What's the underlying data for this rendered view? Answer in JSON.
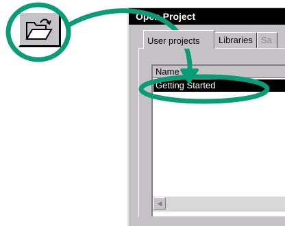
{
  "toolbar": {
    "open_button_icon": "open-folder-icon"
  },
  "dialog": {
    "title": "Open Project",
    "tabs": [
      {
        "label": "User projects",
        "active": true
      },
      {
        "label": "Libraries",
        "active": false
      },
      {
        "label": "Sa",
        "active": false,
        "disabled": true
      }
    ],
    "list": {
      "column_header": "Name",
      "selected_item": "Getting Started"
    }
  },
  "annotation": {
    "color": "#0a9c77",
    "icon": "curved-arrow"
  },
  "colors": {
    "dialog_bg": "#c6c3c6",
    "selection": "#000000",
    "annotation": "#0a9c77"
  }
}
